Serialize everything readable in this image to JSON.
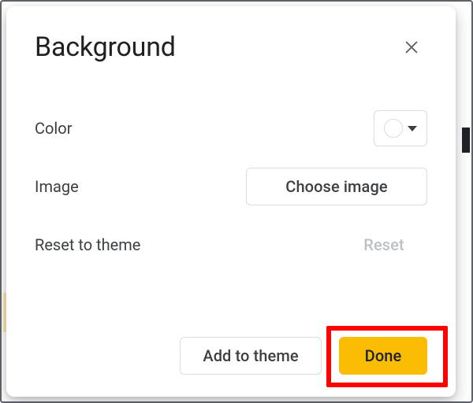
{
  "dialog": {
    "title": "Background",
    "fields": {
      "color_label": "Color",
      "image_label": "Image",
      "reset_label": "Reset to theme",
      "choose_image_button": "Choose image",
      "reset_button": "Reset"
    },
    "actions": {
      "add_to_theme": "Add to theme",
      "done": "Done"
    },
    "color_value": "#ffffff"
  }
}
